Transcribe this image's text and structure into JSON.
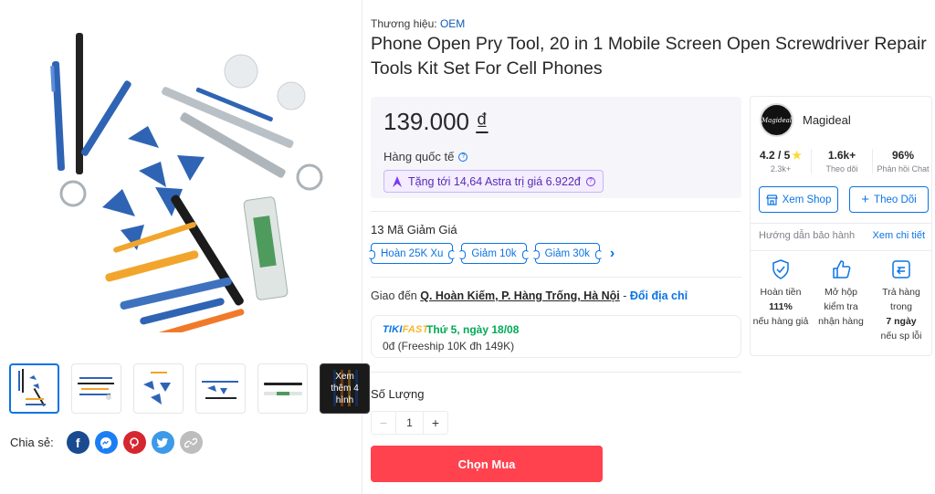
{
  "gallery": {
    "more_label": "Xem thêm 4 hình",
    "share_label": "Chia sẻ:",
    "share_icons": [
      "facebook-icon",
      "messenger-icon",
      "pinterest-icon",
      "twitter-icon",
      "copy-link-icon"
    ]
  },
  "product": {
    "brand_label": "Thương hiệu:",
    "brand_name": "OEM",
    "title": "Phone Open Pry Tool, 20 in 1 Mobile Screen Open Screwdriver Repair Tools Kit Set For Cell Phones",
    "price": "139.000",
    "currency": "₫",
    "origin": "Hàng quốc tế",
    "astra_text": "Tặng tới 14,64 Astra trị giá 6.922đ"
  },
  "coupons": {
    "title": "13 Mã Giảm Giá",
    "items": [
      "Hoàn 25K Xu",
      "Giảm 10k",
      "Giảm 30k"
    ]
  },
  "shipping": {
    "prefix": "Giao đến",
    "address": "Q. Hoàn Kiếm, P. Hàng Trống, Hà Nội",
    "dash": " - ",
    "change": "Đổi địa chỉ",
    "tikifast_1": "TIKI",
    "tikifast_2": "FAST",
    "date": "Thứ 5, ngày 18/08",
    "fee": "0đ (Freeship 10K đh 149K)"
  },
  "quantity": {
    "label": "Số Lượng",
    "minus": "−",
    "value": "1",
    "plus": "+"
  },
  "buy_label": "Chọn Mua",
  "seller": {
    "logo_text": "Magideal",
    "name": "Magideal",
    "rating": "4.2 / 5",
    "rating_count": "2.3k+",
    "followers": "1.6k+",
    "followers_label": "Theo dõi",
    "response": "96%",
    "response_label": "Phản hồi Chat",
    "view_shop": "Xem Shop",
    "follow": "Theo Dõi",
    "warranty_label": "Hướng dẫn bảo hành",
    "warranty_link": "Xem chi tiết",
    "guarantees": [
      {
        "line1": "Hoàn tiền",
        "bold": "111%",
        "line3": "nếu hàng giả"
      },
      {
        "line1": "Mở hộp",
        "line2": "kiểm tra",
        "line3": "nhận hàng"
      },
      {
        "line1": "Trả hàng",
        "line2": "trong",
        "bold": "7 ngày",
        "line3": "nếu sp lỗi"
      }
    ]
  },
  "colors": {
    "primary_blue": "#0b74e5",
    "buy_red": "#ff424e",
    "green": "#00ab56",
    "astra_purple": "#5a2bb5"
  }
}
